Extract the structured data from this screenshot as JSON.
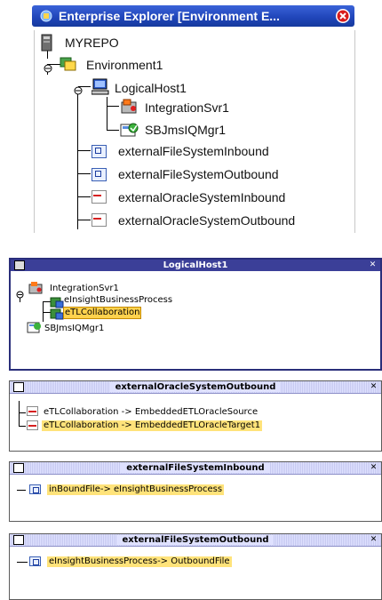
{
  "explorer": {
    "title": "Enterprise Explorer [Environment E...",
    "nodes": {
      "repo": "MYREPO",
      "environment": "Environment1",
      "logical_host": "LogicalHost1",
      "integration_server": "IntegrationSvr1",
      "jms_manager": "SBJmsIQMgr1",
      "fs_inbound": "externalFileSystemInbound",
      "fs_outbound": "externalFileSystemOutbound",
      "oracle_inbound": "externalOracleSystemInbound",
      "oracle_outbound": "externalOracleSystemOutbound"
    }
  },
  "logical_host_panel": {
    "title": "LogicalHost1",
    "integration_server": "IntegrationSvr1",
    "process": "eInsightBusinessProcess",
    "collaboration": "eTLCollaboration",
    "jms_manager": "SBJmsIQMgr1"
  },
  "oracle_outbound_panel": {
    "title": "externalOracleSystemOutbound",
    "rows": [
      "eTLCollaboration -> EmbeddedETLOracleSource",
      "eTLCollaboration -> EmbeddedETLOracleTarget1"
    ]
  },
  "fs_inbound_panel": {
    "title": "externalFileSystemInbound",
    "row": "inBoundFile-> eInsightBusinessProcess"
  },
  "fs_outbound_panel": {
    "title": "externalFileSystemOutbound",
    "row": "eInsightBusinessProcess-> OutboundFile"
  },
  "icons": {
    "close": "close-icon",
    "repository": "repository-icon",
    "environment": "environment-icon",
    "host": "computer-icon",
    "server": "server-icon",
    "queue": "queue-manager-icon",
    "file": "file-system-icon",
    "oracle": "oracle-icon"
  },
  "colors": {
    "titlebar_blue": "#1f44b8",
    "panel_dark": "#3b3f98",
    "highlight": "#ffe37a",
    "selection": "#ffd24d"
  }
}
